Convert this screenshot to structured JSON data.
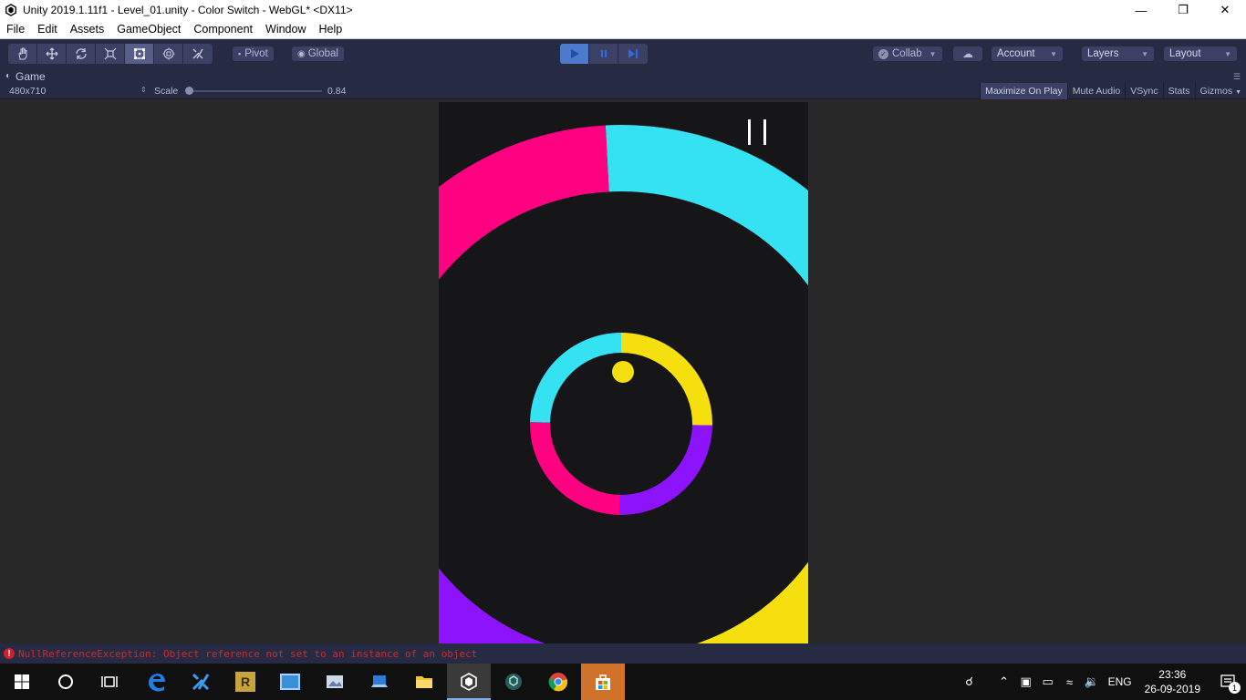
{
  "window": {
    "title": "Unity 2019.1.11f1 - Level_01.unity - Color Switch - WebGL* <DX11>",
    "minimize_icon": "minimize-icon",
    "restore_icon": "restore-icon",
    "close_icon": "close-icon"
  },
  "menu": {
    "items": [
      "File",
      "Edit",
      "Assets",
      "GameObject",
      "Component",
      "Window",
      "Help"
    ]
  },
  "toolbar": {
    "tools": [
      "hand-icon",
      "move-icon",
      "rotate-icon",
      "scale-icon",
      "rect-tool-icon",
      "transform-icon",
      "custom-tool-icon"
    ],
    "active_tool": "rect-tool-icon",
    "pivot_label": "Pivot",
    "global_label": "Global",
    "collab_label": "Collab",
    "account_label": "Account",
    "layers_label": "Layers",
    "layout_label": "Layout",
    "play_state": "playing"
  },
  "game_tab": {
    "label": "Game"
  },
  "game_toolbar": {
    "resolution": "480x710",
    "scale_label": "Scale",
    "scale_value": "0.84",
    "maximize_on_play": "Maximize On Play",
    "mute_audio": "Mute Audio",
    "vsync": "VSync",
    "stats": "Stats",
    "gizmos": "Gizmos"
  },
  "game": {
    "colors": {
      "cyan": "#35e2f2",
      "yellow": "#f6df0e",
      "purple": "#8c13fb",
      "magenta": "#ff0181",
      "background": "#161619"
    },
    "pause_icon": "pause-icon"
  },
  "console": {
    "error_text": "NullReferenceException: Object reference not set to an instance of an object"
  },
  "taskbar": {
    "apps": [
      "start-icon",
      "cortana-icon",
      "task-view-icon",
      "edge-icon",
      "tools-icon",
      "rider-icon",
      "app-icon",
      "photos-icon",
      "devices-icon",
      "file-explorer-icon",
      "unity-icon",
      "unity-hub-icon",
      "chrome-icon",
      "store-icon"
    ],
    "language": "ENG",
    "time": "23:36",
    "date": "26-09-2019",
    "notification_count": "1"
  }
}
